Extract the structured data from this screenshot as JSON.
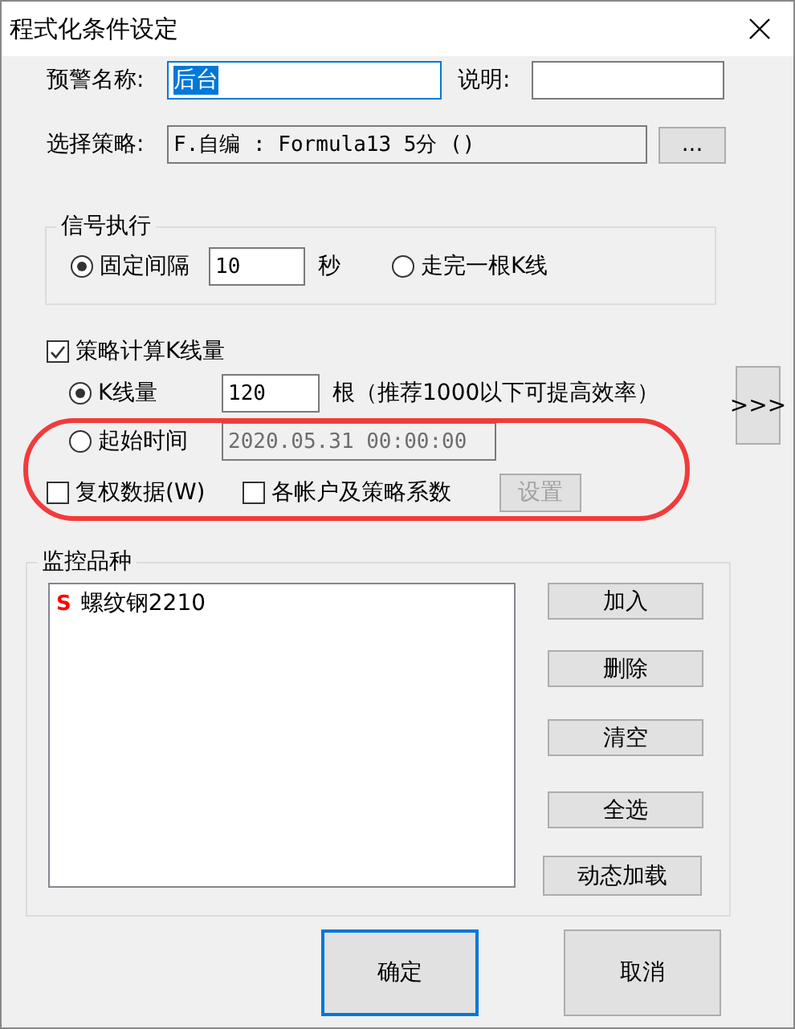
{
  "window": {
    "title": "程式化条件设定"
  },
  "alert_name": {
    "label": "预警名称:",
    "value": "后台",
    "focused": true
  },
  "description": {
    "label": "说明:"
  },
  "strategy": {
    "label": "选择策略:",
    "value": "F.自编 : Formula13 5分 ()",
    "button": "..."
  },
  "signal_execution": {
    "title": "信号执行",
    "interval": {
      "label": "固定间隔",
      "selected": true,
      "value": "10",
      "unit": "秒"
    },
    "bar_close": {
      "label": "走完一根K线",
      "selected": false
    }
  },
  "bar_count": {
    "label": "策略计算K线量",
    "checked": true,
    "count": {
      "label": "K线量",
      "selected": true,
      "value": "120",
      "hint": "根（推荐1000以下可提高效率）"
    },
    "start_time": {
      "label": "起始时间",
      "selected": false,
      "value": "2020.05.31 00:00:00",
      "disabled": true
    }
  },
  "expand_button": ">>>",
  "adjusted_data": {
    "label": "复权数据(W)",
    "checked": false
  },
  "account_coefficients": {
    "label": "各帐户及策略系数",
    "checked": false
  },
  "settings_button": {
    "label": "设置",
    "disabled": true
  },
  "symbols": {
    "title": "监控品种",
    "items": [
      {
        "tag": "S",
        "name": "螺纹钢2210"
      }
    ],
    "buttons": [
      "加入",
      "删除",
      "清空",
      "全选",
      "动态加载"
    ]
  },
  "footer_buttons": [
    {
      "label": "确定",
      "focused": true
    },
    {
      "label": "取消",
      "focused": false
    }
  ],
  "annotation": {
    "kind": "ellipse"
  }
}
